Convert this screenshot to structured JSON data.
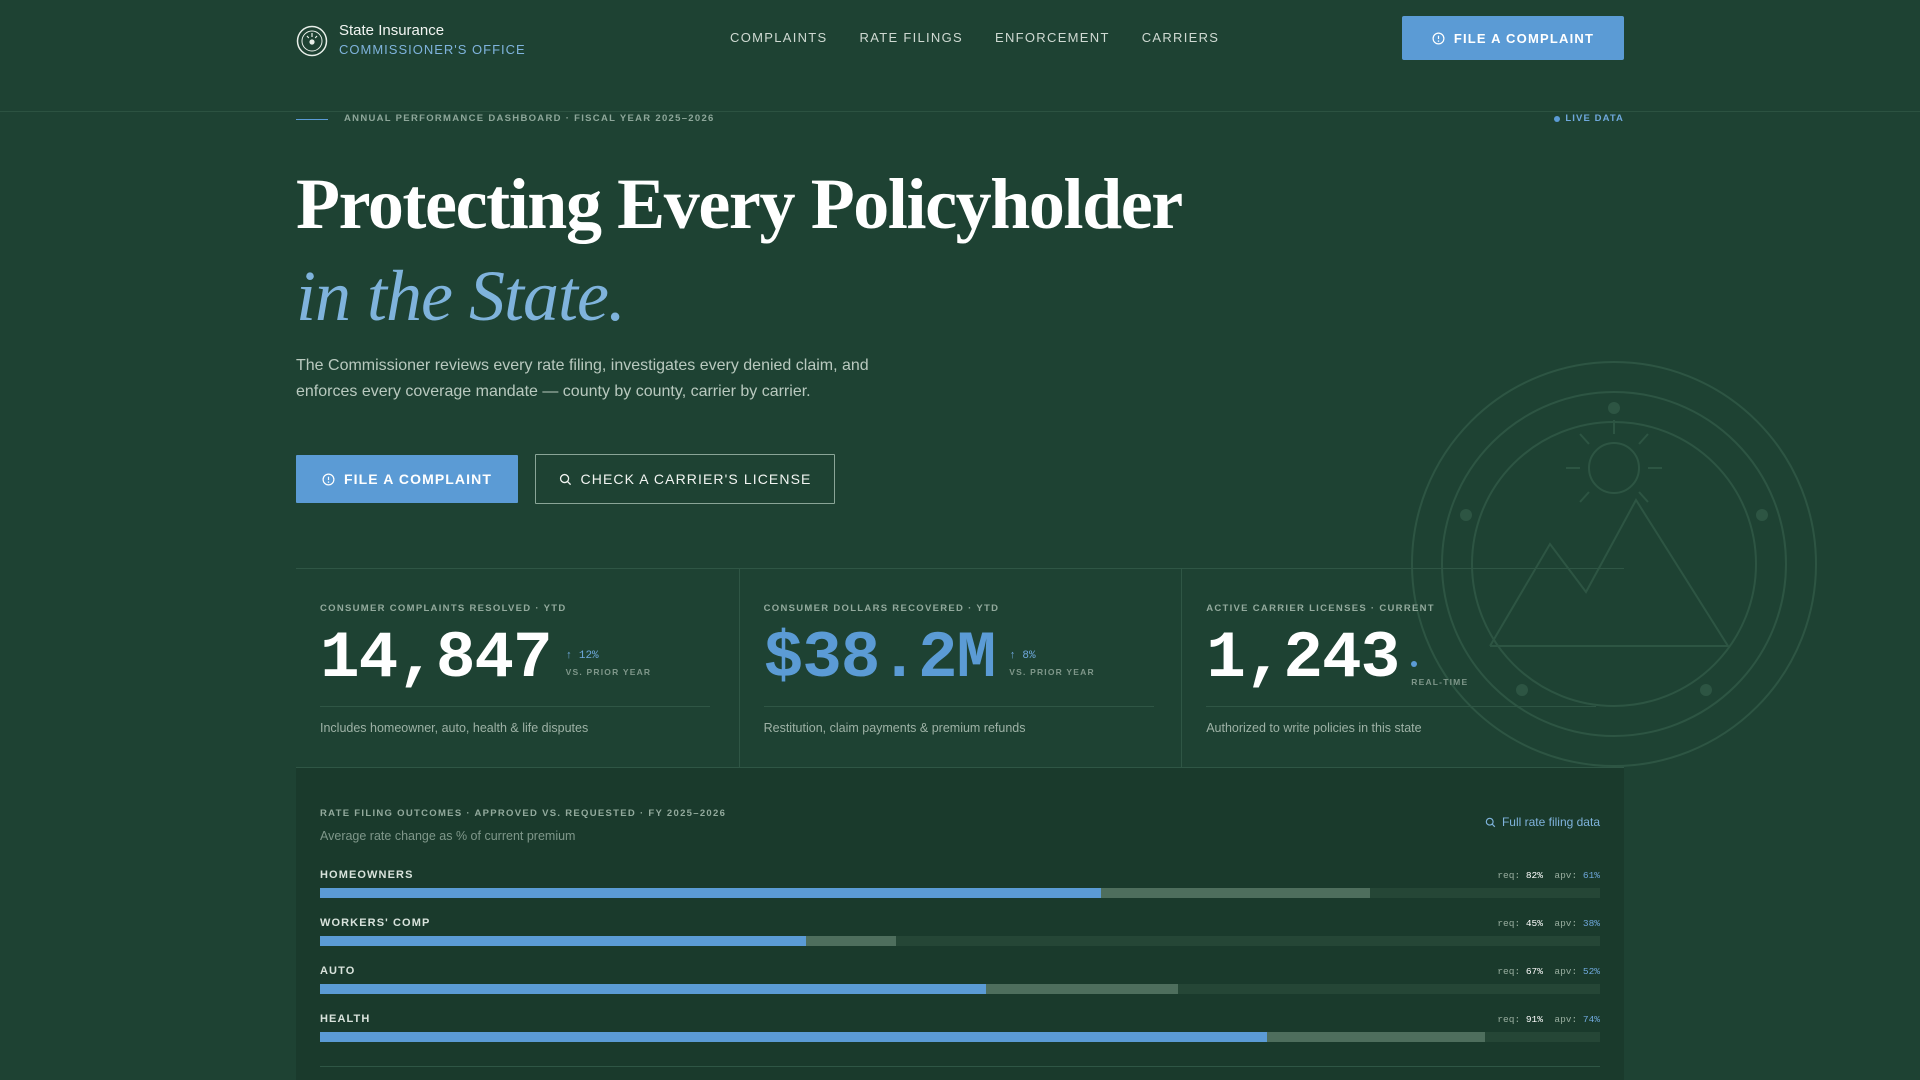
{
  "brand": {
    "line1": "State Insurance",
    "line2": "COMMISSIONER'S OFFICE"
  },
  "nav": {
    "links": [
      "COMPLAINTS",
      "RATE FILINGS",
      "ENFORCEMENT",
      "CARRIERS"
    ],
    "cta_label": "FILE A COMPLAINT"
  },
  "eyebrow": {
    "text": "ANNUAL PERFORMANCE DASHBOARD · FISCAL YEAR 2025–2026",
    "live": "LIVE DATA"
  },
  "hero": {
    "title": "Protecting Every Policyholder",
    "subtitle": "in the State.",
    "description": "The Commissioner reviews every rate filing, investigates every denied claim, and enforces every coverage mandate — county by county, carrier by carrier.",
    "primary_button": "FILE A COMPLAINT",
    "secondary_button": "CHECK A CARRIER'S LICENSE"
  },
  "stats": [
    {
      "label": "CONSUMER COMPLAINTS RESOLVED · YTD",
      "value": "14,847",
      "delta": "↑ 12%",
      "delta_label": "VS. PRIOR YEAR",
      "note": "Includes homeowner, auto, health & life disputes"
    },
    {
      "label": "CONSUMER DOLLARS RECOVERED · YTD",
      "value": "$38.2M",
      "delta": "↑ 8%",
      "delta_label": "VS. PRIOR YEAR",
      "note": "Restitution, claim payments & premium refunds"
    },
    {
      "label": "ACTIVE CARRIER LICENSES · CURRENT",
      "value": "1,243",
      "delta_label": "REAL-TIME",
      "note": "Authorized to write policies in this state"
    }
  ],
  "rate_filing": {
    "title": "RATE FILING OUTCOMES · APPROVED VS. REQUESTED · FY 2025–2026",
    "subtitle": "Average rate change as % of current premium",
    "link": "Full rate filing data",
    "req_prefix": "req:",
    "apv_prefix": "apv:",
    "rows": [
      {
        "label": "HOMEOWNERS",
        "req": "82%",
        "apv": "61%",
        "req_val": 82,
        "apv_val": 61
      },
      {
        "label": "WORKERS' COMP",
        "req": "45%",
        "apv": "38%",
        "req_val": 45,
        "apv_val": 38
      },
      {
        "label": "AUTO",
        "req": "67%",
        "apv": "52%",
        "req_val": 67,
        "apv_val": 52
      },
      {
        "label": "HEALTH",
        "req": "91%",
        "apv": "74%",
        "req_val": 91,
        "apv_val": 74
      }
    ]
  },
  "colors": {
    "background": "#1e4233",
    "accent": "#5b9bd5",
    "accent_light": "#7fb3dc"
  },
  "icons": {
    "seal": "state-seal-icon",
    "alert": "alert-circle-icon",
    "search": "search-icon"
  }
}
